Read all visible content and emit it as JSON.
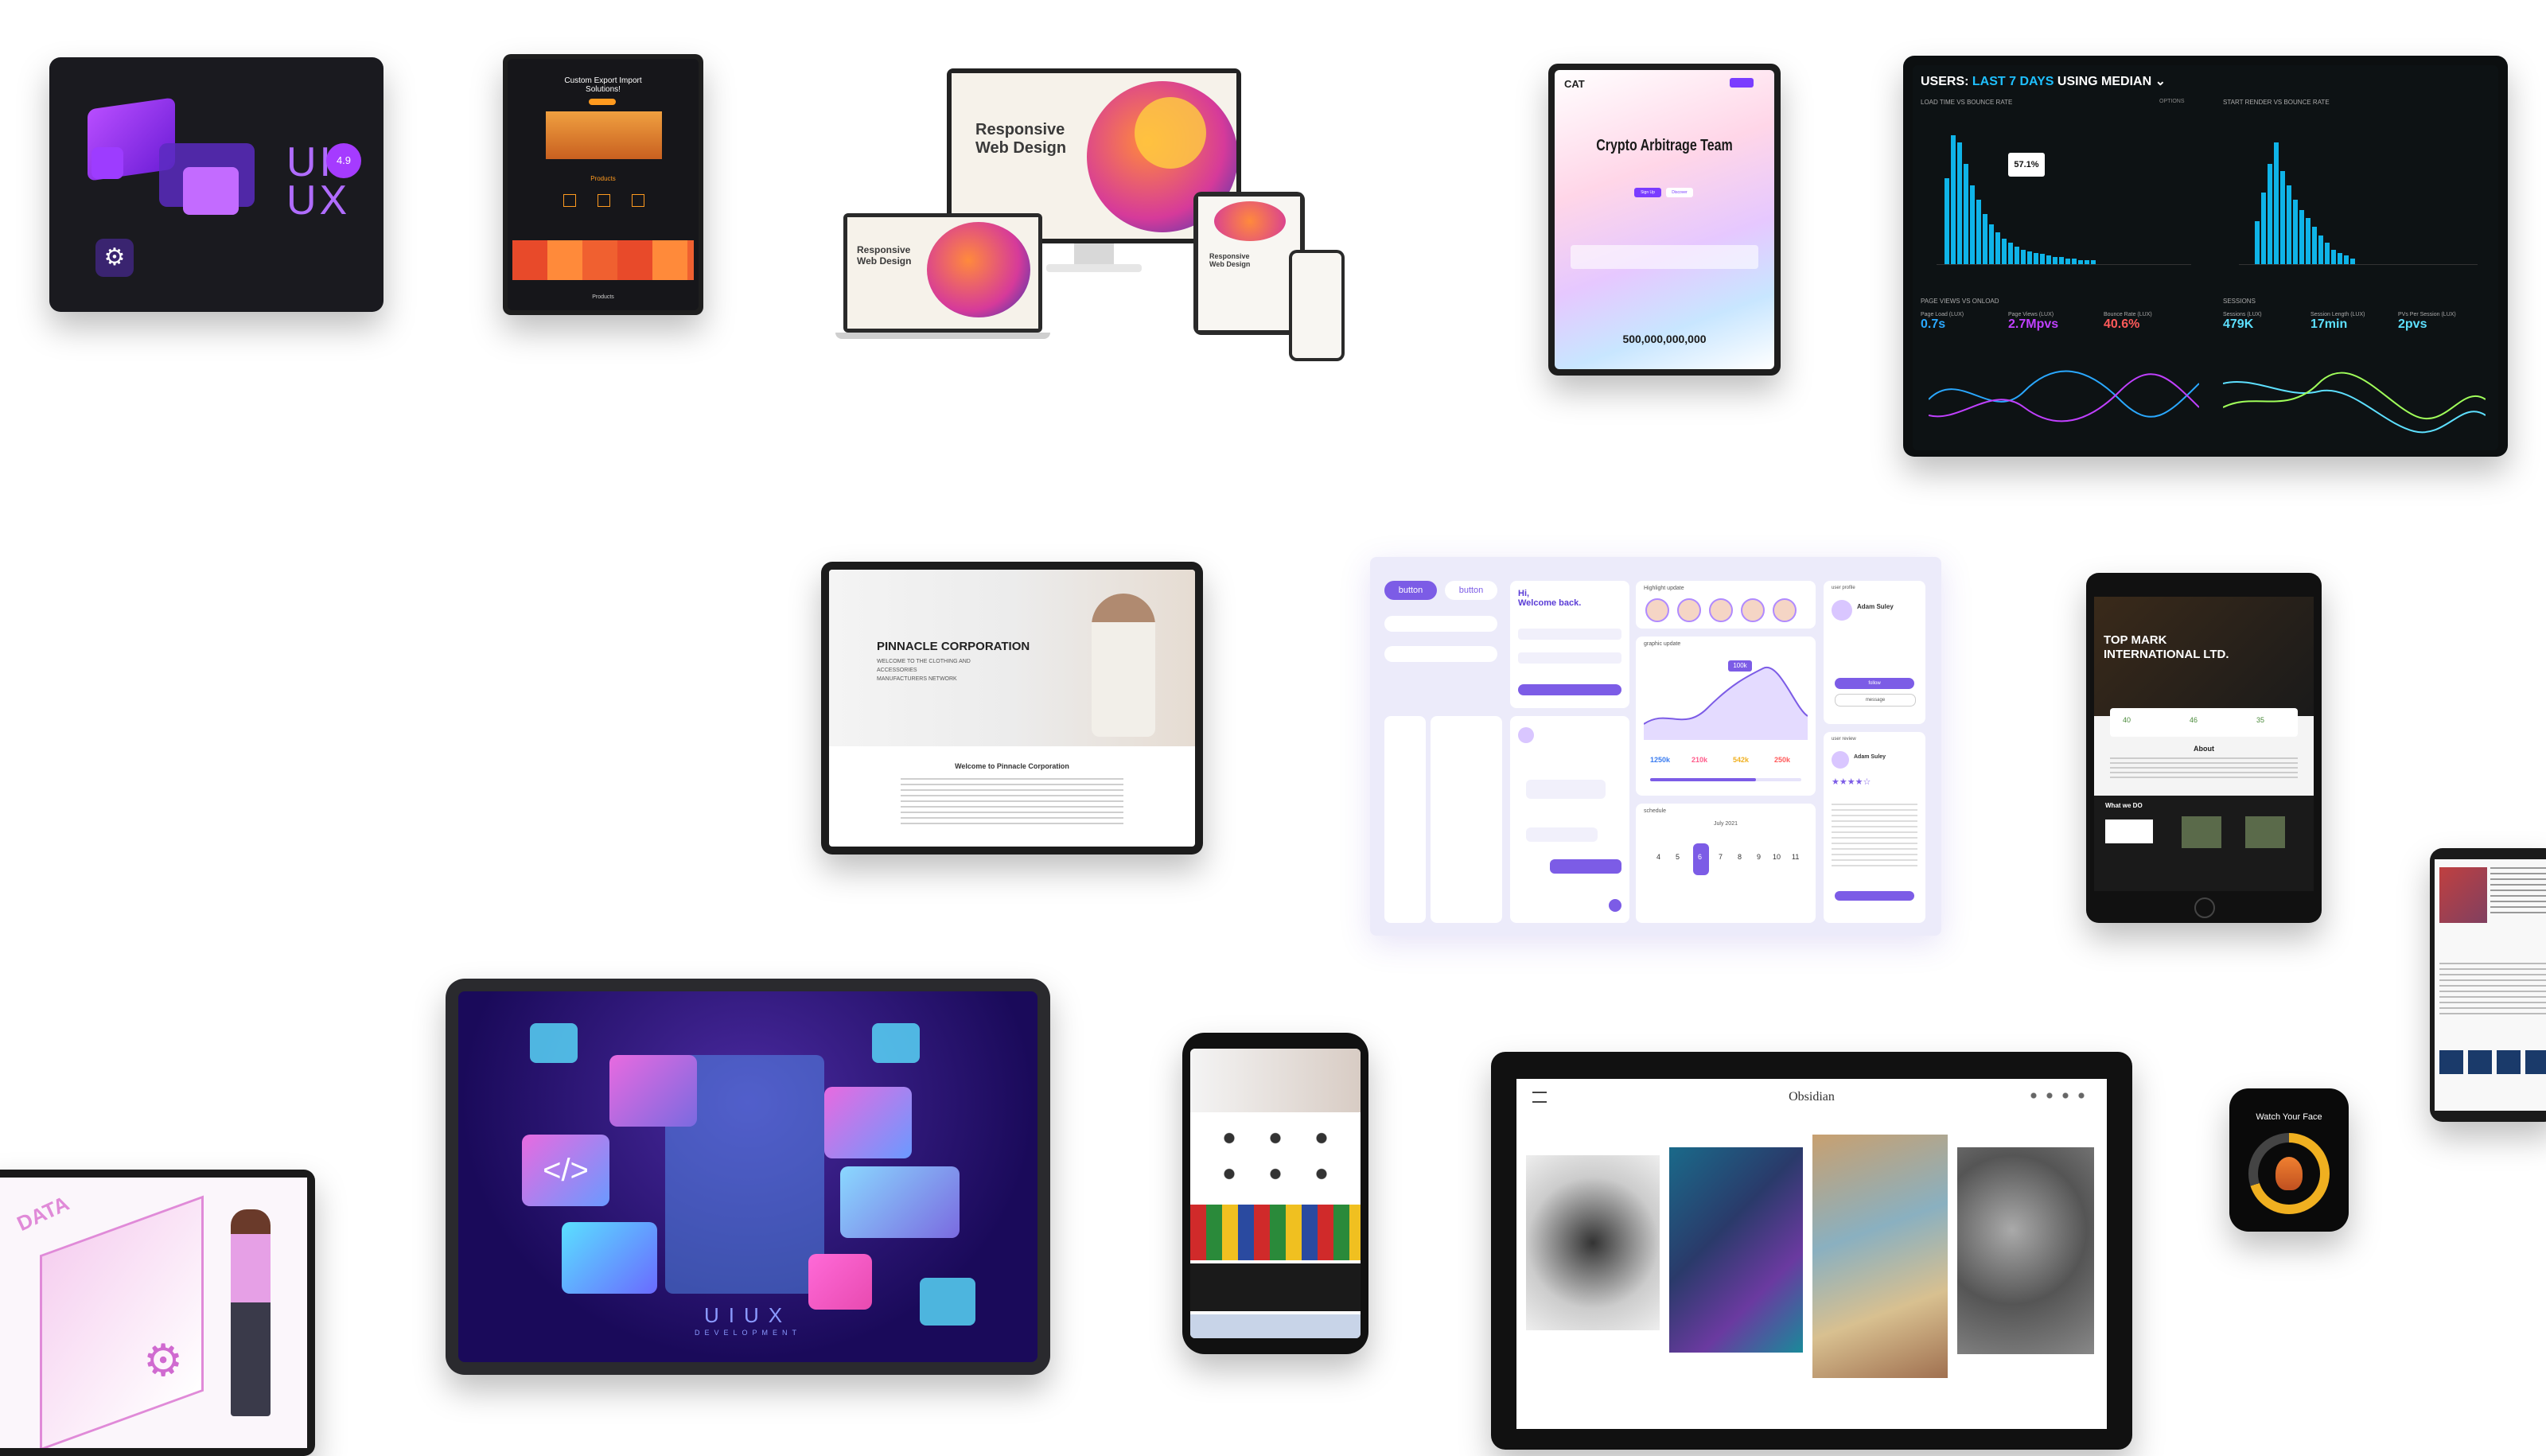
{
  "uiux_tablet": {
    "ux_label": "UI\nUX",
    "badge": "4.9"
  },
  "export_tablet": {
    "title": "Custom Export Import\nSolutions!",
    "section": "Products",
    "footer": "Products"
  },
  "responsive": {
    "heading": "Responsive\nWeb Design"
  },
  "crypto": {
    "brand": "CAT",
    "title": "Crypto Arbitrage Team",
    "amount": "500,000,000,000",
    "btn1": "Sign Up",
    "btn2": "Discover"
  },
  "analytics": {
    "title_prefix": "USERS:",
    "title_accent": "LAST 7 DAYS",
    "title_suffix": "USING MEDIAN",
    "chart1_title": "LOAD TIME VS BOUNCE RATE",
    "chart2_title": "START RENDER VS BOUNCE RATE",
    "tooltip": "57.1%",
    "options": "OPTIONS",
    "section1": "PAGE VIEWS VS ONLOAD",
    "section2": "SESSIONS",
    "metrics": [
      {
        "label": "Page Load (LUX)",
        "value": "0.7s",
        "color": "#2aa8ff"
      },
      {
        "label": "Page Views (LUX)",
        "value": "2.7Mpvs",
        "color": "#c040ff"
      },
      {
        "label": "Bounce Rate (LUX)",
        "value": "40.6%",
        "color": "#ff5a5a"
      },
      {
        "label": "Sessions (LUX)",
        "value": "479K",
        "color": "#5de0ff"
      },
      {
        "label": "Session Length (LUX)",
        "value": "17min",
        "color": "#5de0ff"
      },
      {
        "label": "PVs Per Session (LUX)",
        "value": "2pvs",
        "color": "#5de0ff"
      }
    ]
  },
  "pinnacle": {
    "title": "PINNACLE CORPORATION",
    "subtitle": "WELCOME TO THE CLOTHING AND\nACCESSORIES\nMANUFACTURERS NETWORK",
    "welcome": "Welcome to Pinnacle Corporation"
  },
  "dashboard": {
    "button_primary": "button",
    "button_secondary": "button",
    "greeting": "Hi,\nWelcome back.",
    "highlight": "Highlight update",
    "graphic": "graphic update",
    "schedule": "schedule",
    "month": "July 2021",
    "peak": "100k",
    "stats": [
      "1250k",
      "210k",
      "542k",
      "250k"
    ],
    "profile_label": "user profile",
    "profile_name": "Adam Suley",
    "review_label": "user review",
    "review_name": "Adam Suley",
    "follow": "follow",
    "message": "message",
    "days": [
      "4",
      "5",
      "6",
      "7",
      "8",
      "9",
      "10",
      "11"
    ]
  },
  "topmark": {
    "title": "TOP MARK\nINTERNATIONAL LTD.",
    "about": "About",
    "what": "What we DO",
    "stats": [
      "40",
      "46",
      "35"
    ]
  },
  "uiux_big": {
    "label": "UIUX",
    "sub": "DEVELOPMENT"
  },
  "data_label": "DATA",
  "gallery": {
    "title": "Obsidian"
  },
  "watch": {
    "label": "Watch Your Face"
  }
}
